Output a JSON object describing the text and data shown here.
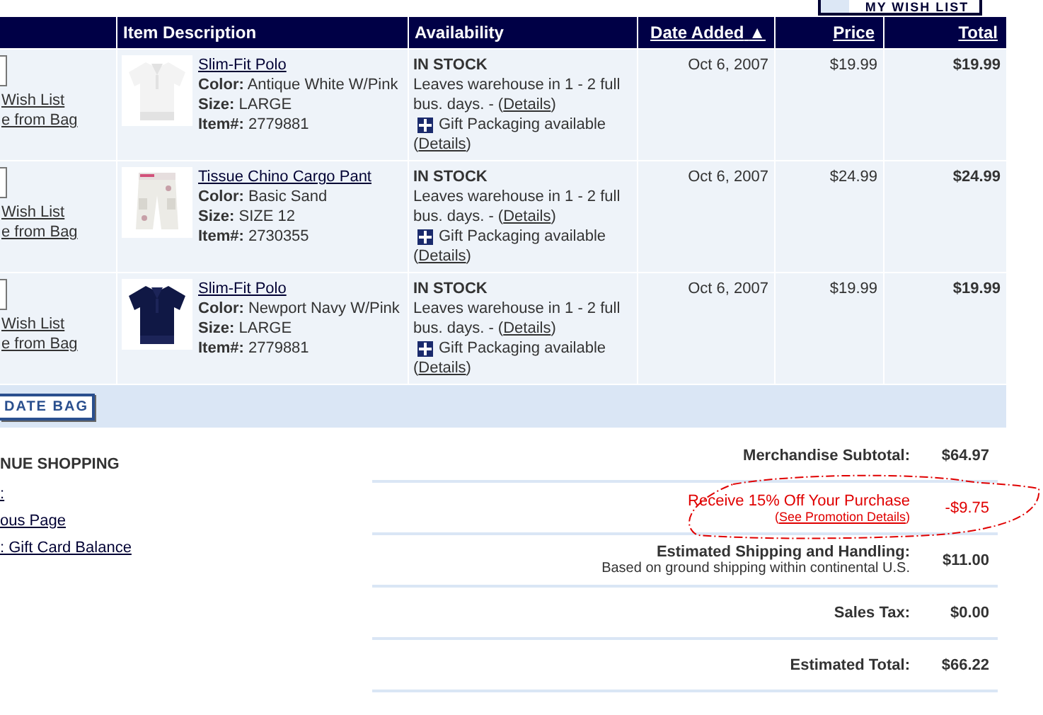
{
  "wish_list_button": "MY WISH LIST",
  "columns": [
    {
      "label": "Item Description",
      "kind": "plain"
    },
    {
      "label": "Availability",
      "kind": "plain"
    },
    {
      "label": "Date Added",
      "kind": "link",
      "sort_mark": "▲"
    },
    {
      "label": "Price",
      "kind": "link"
    },
    {
      "label": "Total",
      "kind": "link"
    }
  ],
  "items": [
    {
      "wish_link": "Wish List",
      "remove_link": "e from Bag",
      "name": "Slim-Fit Polo",
      "details": [
        {
          "label": "Color:",
          "value": "Antique White W/Pink"
        },
        {
          "label": "Size:",
          "value": "LARGE"
        },
        {
          "label": "Item#:",
          "value": "2779881"
        }
      ],
      "status": "IN STOCK",
      "note": "Leaves warehouse in 1 - 2 full bus. days. - (",
      "note_link": "Details",
      "note_end": ")",
      "gift": "Gift Packaging available",
      "gift_open": "(",
      "gift_link": "Details",
      "gift_close": ")",
      "date": "Oct 6, 2007",
      "price": "$19.99",
      "total": "$19.99"
    },
    {
      "wish_link": "Wish List",
      "remove_link": "e from Bag",
      "name": "Tissue Chino Cargo Pant",
      "details": [
        {
          "label": "Color:",
          "value": "Basic Sand"
        },
        {
          "label": "Size:",
          "value": "SIZE 12"
        },
        {
          "label": "Item#:",
          "value": "2730355"
        }
      ],
      "status": "IN STOCK",
      "note": "Leaves warehouse in 1 - 2 full bus. days. - (",
      "note_link": "Details",
      "note_end": ")",
      "gift": "Gift Packaging available",
      "gift_open": "(",
      "gift_link": "Details",
      "gift_close": ")",
      "date": "Oct 6, 2007",
      "price": "$24.99",
      "total": "$24.99"
    },
    {
      "wish_link": "Wish List",
      "remove_link": "e from Bag",
      "name": "Slim-Fit Polo",
      "details": [
        {
          "label": "Color:",
          "value": "Newport Navy W/Pink"
        },
        {
          "label": "Size:",
          "value": "LARGE"
        },
        {
          "label": "Item#:",
          "value": "2779881"
        }
      ],
      "status": "IN STOCK",
      "note": "Leaves warehouse in 1 - 2 full bus. days. - (",
      "note_link": "Details",
      "note_end": ")",
      "gift": "Gift Packaging available",
      "gift_open": "(",
      "gift_link": "Details",
      "gift_close": ")",
      "date": "Oct 6, 2007",
      "price": "$19.99",
      "total": "$19.99"
    }
  ],
  "update_button": "DATE BAG",
  "continue_shopping": {
    "heading": "NUE SHOPPING",
    "links": [
      ":",
      "ous Page",
      ": Gift Card Balance"
    ]
  },
  "summary": [
    {
      "kind": "plain",
      "label": "Merchandise Subtotal:",
      "amount": "$64.97"
    },
    {
      "kind": "promo",
      "label": "Receive 15% Off Your Purchase",
      "open": "(",
      "link": "See Promotion Details",
      "close": ")",
      "amount": "-$9.75"
    },
    {
      "kind": "note",
      "label": "Estimated Shipping and Handling:",
      "note": "Based on ground shipping within continental U.S.",
      "amount": "$11.00"
    },
    {
      "kind": "plain",
      "label": "Sales Tax:",
      "amount": "$0.00"
    },
    {
      "kind": "plain",
      "label": "Estimated Total:",
      "amount": "$66.22"
    }
  ]
}
